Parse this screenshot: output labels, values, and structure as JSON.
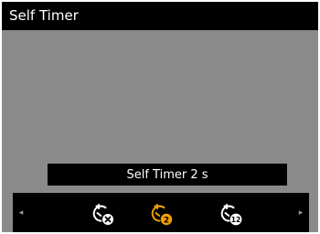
{
  "header": {
    "title": "Self Timer"
  },
  "current_value": {
    "label": "Self Timer 2 s"
  },
  "options": [
    {
      "icon": "self-timer-off-icon",
      "badge": "",
      "selected": false
    },
    {
      "icon": "self-timer-2s-icon",
      "badge": "2",
      "selected": true
    },
    {
      "icon": "self-timer-12s-icon",
      "badge": "12",
      "selected": false
    }
  ],
  "nav": {
    "left": "◂",
    "right": "▸"
  },
  "colors": {
    "selected": "#f0a000",
    "unselected": "#ffffff",
    "background": "#8a8a8a",
    "bar": "#000000"
  }
}
